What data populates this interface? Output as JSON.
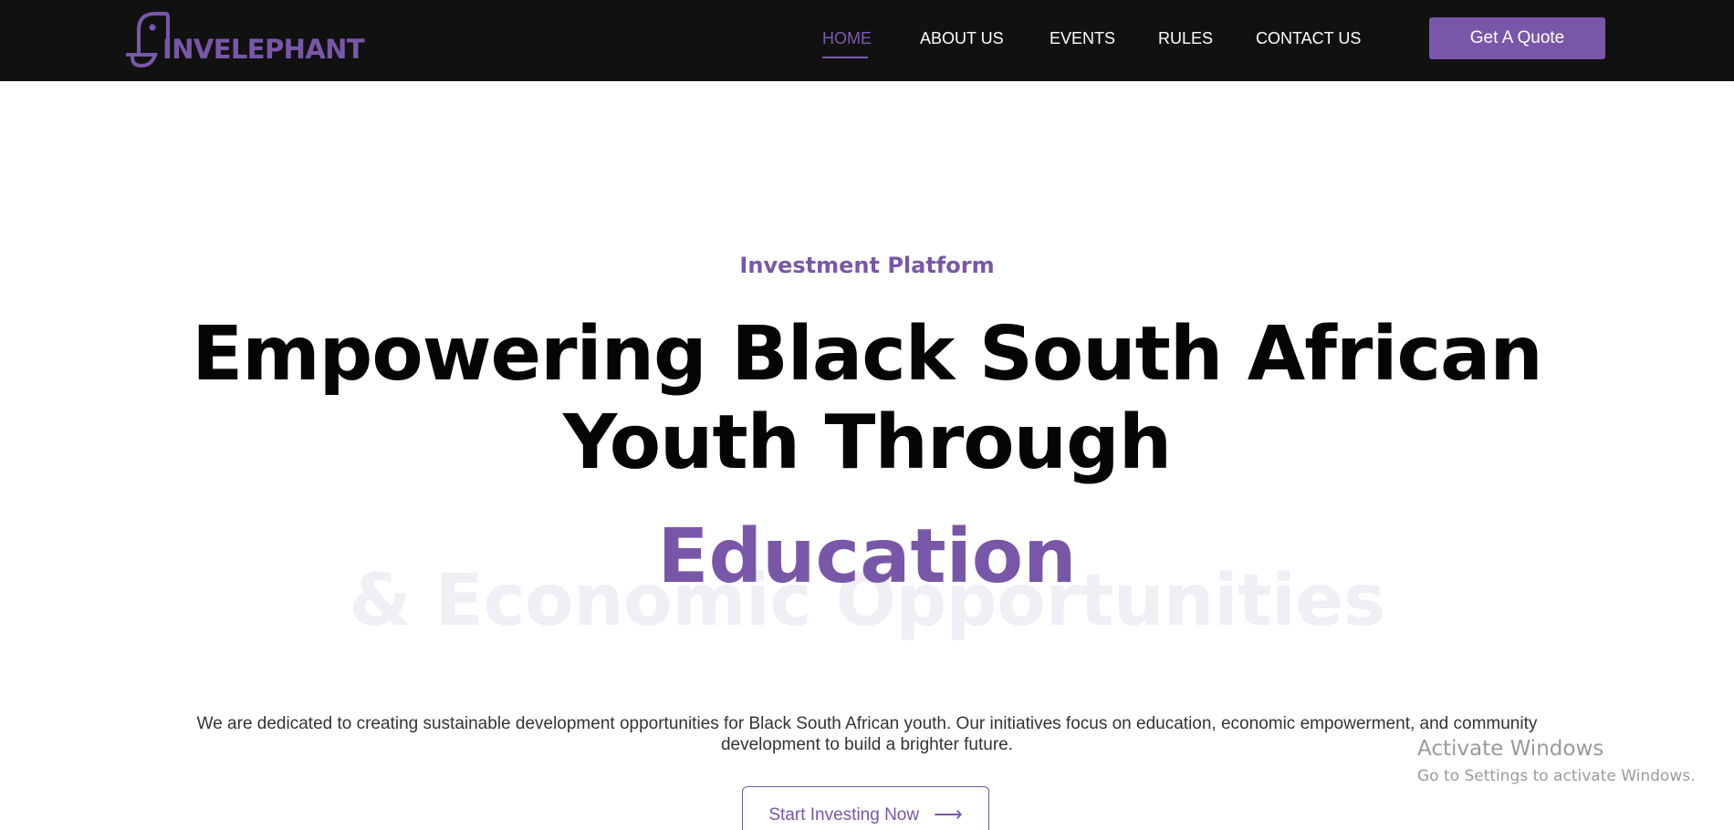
{
  "header": {
    "logo_text": "INVELEPHANT",
    "nav": [
      {
        "label": "HOME",
        "active": true
      },
      {
        "label": "ABOUT US",
        "active": false
      },
      {
        "label": "EVENTS",
        "active": false
      },
      {
        "label": "RULES",
        "active": false
      },
      {
        "label": "CONTACT US",
        "active": false
      }
    ],
    "cta_label": "Get A Quote"
  },
  "hero": {
    "eyebrow": "Investment Platform",
    "headline_line1": "Empowering Black South African",
    "headline_line2": "Youth Through",
    "rotating_word": "Education",
    "rotating_word_next": "& Economic Opportunities",
    "description_line1": "We are dedicated to creating sustainable development opportunities for Black South African youth. Our initiatives focus on education, economic empowerment, and community",
    "description_line2": "development to build a brighter future.",
    "cta_label": "Start Investing Now",
    "cta_arrow": "⟶"
  },
  "system_overlay": {
    "title": "Activate Windows",
    "subtitle": "Go to Settings to activate Windows."
  },
  "colors": {
    "brand_purple": "#7957a8",
    "nav_background": "#111111",
    "headline": "#050505",
    "watermark": "#f1eef5"
  }
}
